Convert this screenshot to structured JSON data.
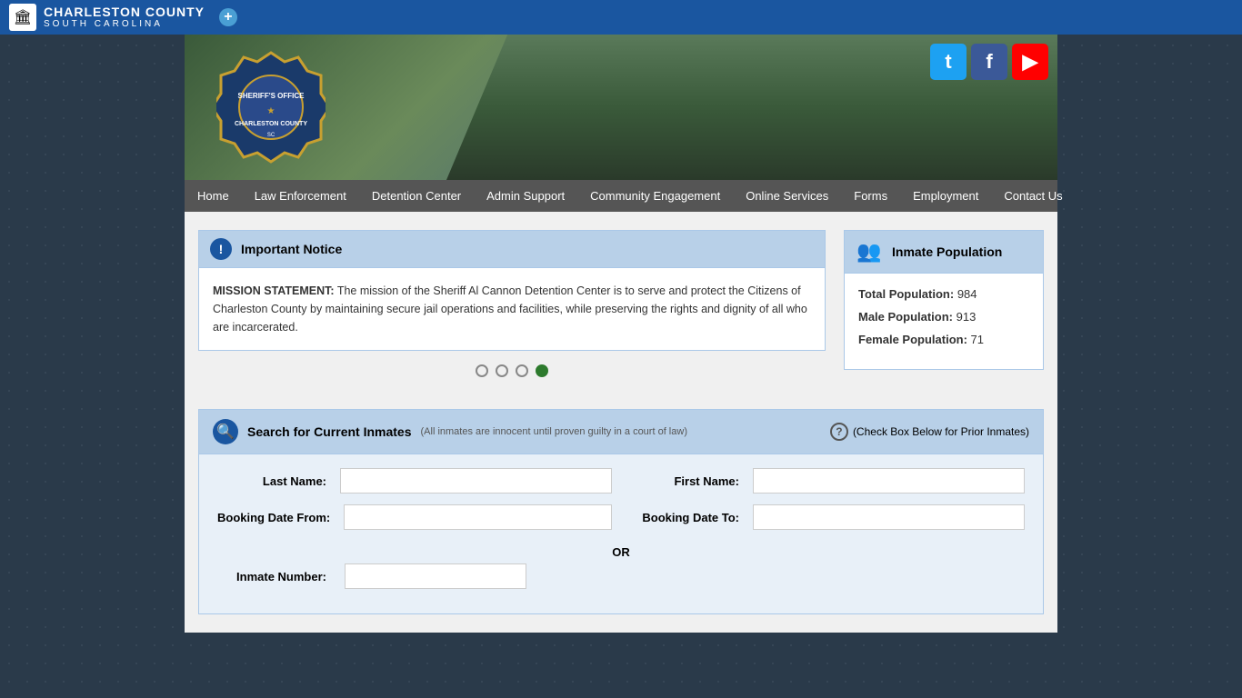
{
  "topbar": {
    "county": "CHARLESTON COUNTY",
    "state": "SOUTH CAROLINA",
    "plus_label": "+"
  },
  "social": {
    "twitter_label": "t",
    "facebook_label": "f",
    "youtube_label": "▶"
  },
  "nav": {
    "items": [
      {
        "label": "Home",
        "id": "home"
      },
      {
        "label": "Law Enforcement",
        "id": "law-enforcement"
      },
      {
        "label": "Detention Center",
        "id": "detention-center"
      },
      {
        "label": "Admin Support",
        "id": "admin-support"
      },
      {
        "label": "Community Engagement",
        "id": "community-engagement"
      },
      {
        "label": "Online Services",
        "id": "online-services"
      },
      {
        "label": "Forms",
        "id": "forms"
      },
      {
        "label": "Employment",
        "id": "employment"
      },
      {
        "label": "Contact Us",
        "id": "contact-us"
      }
    ]
  },
  "notice": {
    "header": "Important Notice",
    "icon": "!",
    "bold_text": "MISSION STATEMENT:",
    "body_text": " The mission of the Sheriff Al Cannon Detention Center is to serve and protect the Citizens of Charleston County by maintaining secure jail operations and facilities, while preserving the rights and dignity of all who are incarcerated."
  },
  "pagination": {
    "dots": [
      1,
      2,
      3,
      4
    ],
    "active": 4
  },
  "inmate_population": {
    "header": "Inmate Population",
    "total_label": "Total Population:",
    "total_value": "984",
    "male_label": "Male Population:",
    "male_value": "913",
    "female_label": "Female Population:",
    "female_value": "71"
  },
  "search": {
    "header": "Search for Current Inmates",
    "subtext": "(All inmates are innocent until proven guilty in a court of law)",
    "prior_label": "(Check Box Below for Prior Inmates)",
    "last_name_label": "Last Name:",
    "first_name_label": "First Name:",
    "booking_from_label": "Booking Date From:",
    "booking_to_label": "Booking Date To:",
    "or_label": "OR",
    "inmate_number_label": "Inmate Number:"
  }
}
